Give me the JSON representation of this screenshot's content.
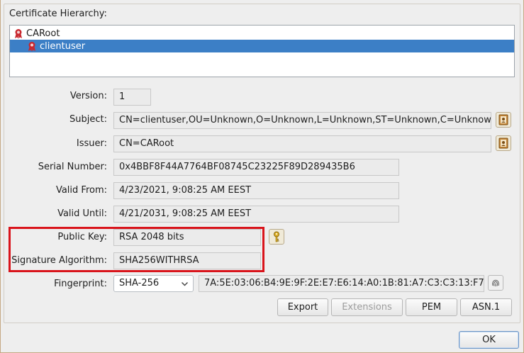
{
  "hierarchy": {
    "label": "Certificate Hierarchy:",
    "items": [
      {
        "label": "CARoot",
        "icon": "certificate-icon",
        "selected": false
      },
      {
        "label": "clientuser",
        "icon": "certificate-icon",
        "selected": true
      }
    ]
  },
  "fields": {
    "version": {
      "label": "Version:",
      "value": "1"
    },
    "subject": {
      "label": "Subject:",
      "value": "CN=clientuser,OU=Unknown,O=Unknown,L=Unknown,ST=Unknown,C=Unknown"
    },
    "issuer": {
      "label": "Issuer:",
      "value": "CN=CARoot"
    },
    "serial": {
      "label": "Serial Number:",
      "value": "0x4BBF8F44A7764BF08745C23225F89D289435B6"
    },
    "valid_from": {
      "label": "Valid From:",
      "value": "4/23/2021, 9:08:25 AM EEST"
    },
    "valid_until": {
      "label": "Valid Until:",
      "value": "4/21/2031, 9:08:25 AM EEST"
    },
    "public_key": {
      "label": "Public Key:",
      "value": "RSA 2048 bits"
    },
    "sig_alg": {
      "label": "Signature Algorithm:",
      "value": "SHA256WITHRSA"
    },
    "fingerprint": {
      "label": "Fingerprint:",
      "algorithm": "SHA-256",
      "value": "7A:5E:03:06:B4:9E:9F:2E:E7:E6:14:A0:1B:81:A7:C3:C3:13:F7:("
    }
  },
  "buttons": {
    "export": "Export",
    "extensions": "Extensions",
    "pem": "PEM",
    "asn1": "ASN.1",
    "ok": "OK"
  },
  "colors": {
    "selection": "#3c7fc6",
    "highlight": "#d9141b"
  }
}
